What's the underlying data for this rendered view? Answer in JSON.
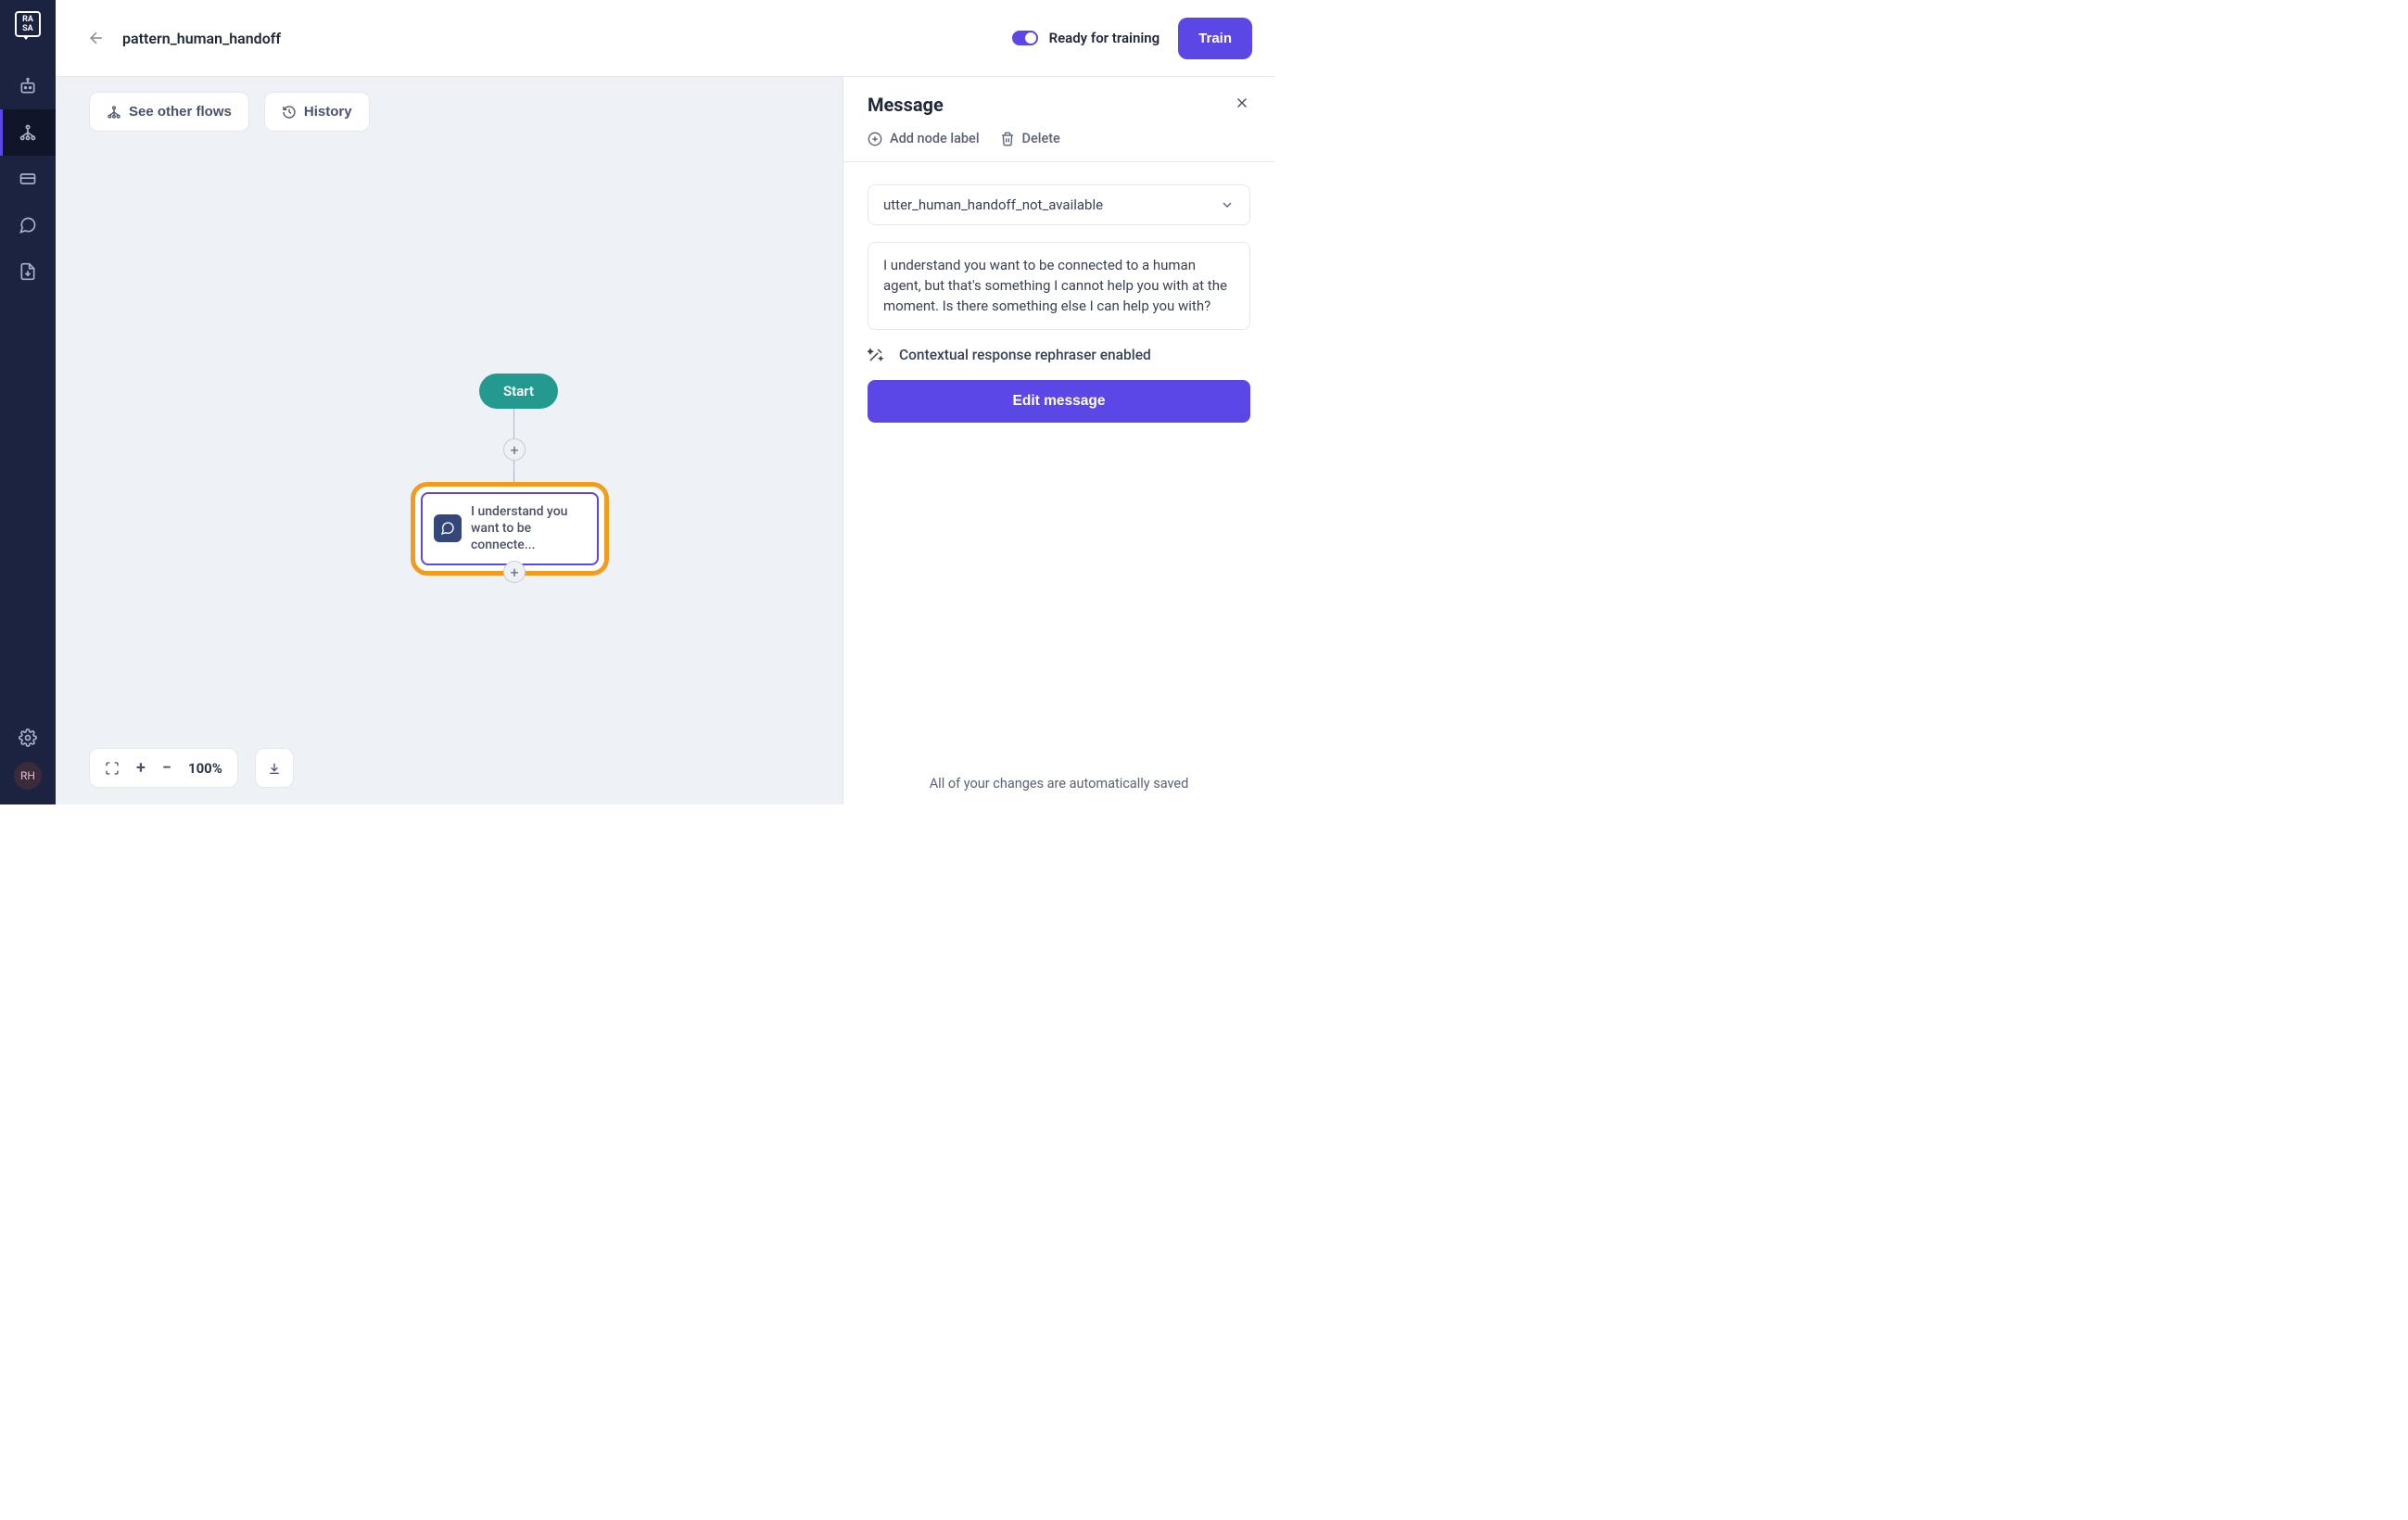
{
  "header": {
    "title": "pattern_human_handoff",
    "toggle_label": "Ready for training",
    "train_label": "Train"
  },
  "canvas_buttons": {
    "see_other_flows": "See other flows",
    "history": "History"
  },
  "flow": {
    "start_label": "Start",
    "message_preview": "I understand you want to be connecte..."
  },
  "zoom": {
    "percent": "100%"
  },
  "panel": {
    "title": "Message",
    "add_label_action": "Add node label",
    "delete_action": "Delete",
    "utter_name": "utter_human_handoff_not_available",
    "message_body": "I understand you want to be connected to a human agent, but that's something I cannot help you with at the moment. Is there something else I can help you with?",
    "rephraser_text": "Contextual response rephraser enabled",
    "edit_button": "Edit message",
    "footer": "All of your changes are automatically saved"
  },
  "avatar": "RH"
}
